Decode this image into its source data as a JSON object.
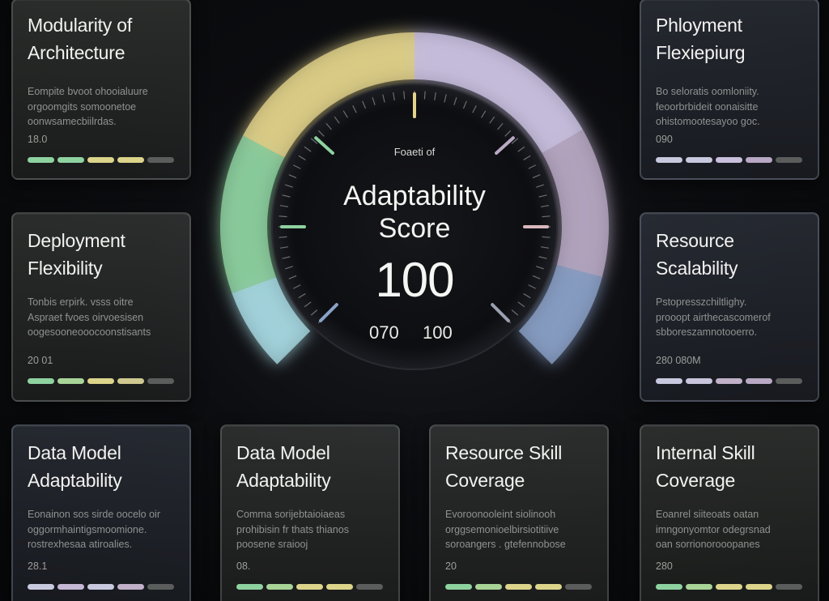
{
  "gauge": {
    "overline": "Foaeti of",
    "title_line1": "Adaptability",
    "title_line2": "Score",
    "value": "100",
    "range_min": "070",
    "range_max": "100",
    "score_fraction": 1.0
  },
  "colors": {
    "green": "#8ed2a0",
    "yellow": "#e3d48a",
    "lavender": "#cdc4e4",
    "mauve": "#b9a9c4",
    "blue": "#8aa2c8",
    "cyan": "#a8dae3",
    "gray": "#5a5d5b"
  },
  "cards": [
    {
      "id": "modularity-architecture",
      "title_line1": "Modularity of",
      "title_line2": "Architecture",
      "body": [
        "Eompite bvoot ohooialuure",
        "orgoomgits somoonetoe",
        "oonwsamecbiilrdas."
      ],
      "value": "18.0",
      "bar_colors": [
        "#8ed2a0",
        "#8ed2a0",
        "#dcd48a",
        "#dcd48a",
        "#5a5d5b"
      ]
    },
    {
      "id": "phloyment-flexiepiurg",
      "title_line1": "Phloyment",
      "title_line2": "Flexiepiurg",
      "body": [
        "Bo seloratis oomloniity.",
        "feoorbrbideit oonaisitte",
        "ohistomootesayoo goc."
      ],
      "value": "090",
      "bar_colors": [
        "#c8c8de",
        "#c8c8de",
        "#c8c0dc",
        "#b8a8c4",
        "#5a5d5b"
      ]
    },
    {
      "id": "deployment-flexibility",
      "title_line1": "Deployment",
      "title_line2": "Flexibility",
      "body": [
        "Tonbis erpirk. vsss oitre",
        "Aspraet fvoes oirvoesisen",
        "oogesooneooocoonstisants"
      ],
      "value": "20 01",
      "bar_colors": [
        "#8ed2a0",
        "#a8d498",
        "#dcd48a",
        "#cfc890",
        "#5a5d5b"
      ]
    },
    {
      "id": "resource-scalability",
      "title_line1": "Resource",
      "title_line2": "Scalability",
      "body": [
        "Pstopresszchiltlighy.",
        "prooopt airthecascomerof",
        "sbboreszamnotooerro."
      ],
      "value": "280 080M",
      "bar_colors": [
        "#c8c8de",
        "#c8c4dc",
        "#c0b0c8",
        "#b8a8c4",
        "#5a5d5b"
      ]
    },
    {
      "id": "data-model-adaptability-1",
      "title_line1": "Data Model",
      "title_line2": "Adaptability",
      "body": [
        "Eonainon sos sirde oocelo oir",
        "oggormhaintigsmoomione.",
        "rostrexhesaa atiroalies."
      ],
      "value": "28.1",
      "bar_colors": [
        "#c8c8de",
        "#c4b8d4",
        "#c8c8de",
        "#c0b0c8",
        "#5a5d5b"
      ]
    },
    {
      "id": "data-model-adaptability-2",
      "title_line1": "Data Model",
      "title_line2": "Adaptability",
      "body": [
        "Comma sorijebtaioiaeas",
        "prohibisin fr thats thianos",
        "poosene sraiooj"
      ],
      "value": "08.",
      "bar_colors": [
        "#8ed2a0",
        "#a8d498",
        "#dcd48a",
        "#dcd48a",
        "#5a5d5b"
      ]
    },
    {
      "id": "resource-skill-coverage",
      "title_line1": "Resource Skill",
      "title_line2": "Coverage",
      "body": [
        "Evoroonooleint siolinooh",
        "orggsemonioelbirsiotitiive",
        "soroangers . gtefennobose"
      ],
      "value": "20",
      "bar_colors": [
        "#8ed2a0",
        "#a8d498",
        "#dcd48a",
        "#dcd48a",
        "#5a5d5b"
      ]
    },
    {
      "id": "internal-skill-coverage",
      "title_line1": "Internal Skill",
      "title_line2": "Coverage",
      "body": [
        "Eoanrel siiteoats oatan",
        "imngonyomtor odegrsnad",
        "oan sorrionorooopanes"
      ],
      "value": "280",
      "bar_colors": [
        "#8ed2a0",
        "#a8d498",
        "#dcd48a",
        "#dcd48a",
        "#5a5d5b"
      ]
    }
  ]
}
